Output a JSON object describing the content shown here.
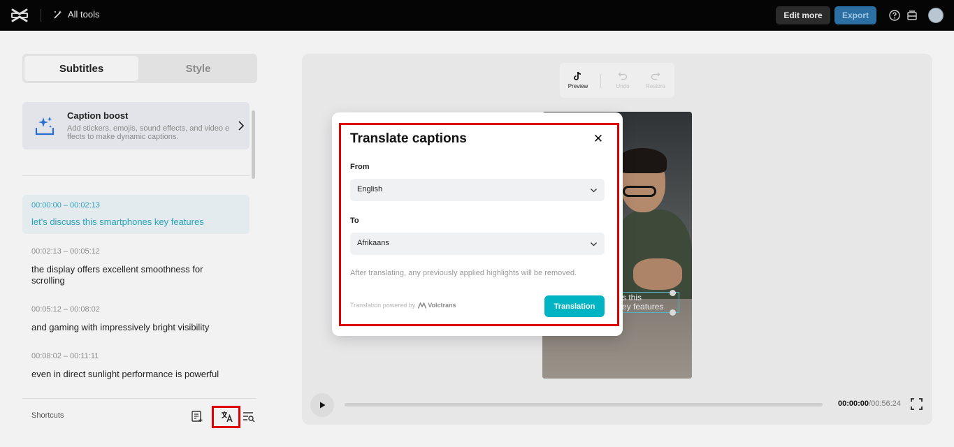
{
  "topbar": {
    "all_tools_label": "All tools",
    "edit_more_label": "Edit more",
    "export_label": "Export"
  },
  "left_panel": {
    "tabs": [
      {
        "label": "Subtitles",
        "active": true
      },
      {
        "label": "Style",
        "active": false
      }
    ],
    "caption_boost": {
      "title": "Caption boost",
      "description": "Add stickers, emojis, sound effects, and video effects to make dynamic captions."
    },
    "subtitles": [
      {
        "time": "00:00:00 – 00:02:13",
        "text": "let's discuss this smartphones key features",
        "active": true
      },
      {
        "time": "00:02:13  – 00:05:12",
        "text": "the display offers excellent smoothness for scrolling",
        "active": false
      },
      {
        "time": "00:05:12  – 00:08:02",
        "text": "and gaming with impressively bright visibility",
        "active": false
      },
      {
        "time": "00:08:02 – 00:11:11",
        "text": "even in direct sunlight performance is powerful",
        "active": false
      }
    ],
    "shortcuts_label": "Shortcuts"
  },
  "preview": {
    "toolbar": {
      "preview_label": "Preview",
      "undo_label": "Undo",
      "restore_label": "Restore"
    },
    "video_caption": "ss this\nkey features",
    "time_current": "00:00:00",
    "time_total": "/00:56:24"
  },
  "modal": {
    "title": "Translate captions",
    "from_label": "From",
    "from_value": "English",
    "to_label": "To",
    "to_value": "Afrikaans",
    "note": "After translating, any previously applied highlights will be removed.",
    "powered_by": "Translation powered by",
    "brand": "Volctrans",
    "translate_button": "Translation"
  },
  "colors": {
    "accent": "#00b4c4",
    "highlight": "#dd0000",
    "topbar": "#050505",
    "active_subtitle": "#29a0b9"
  }
}
